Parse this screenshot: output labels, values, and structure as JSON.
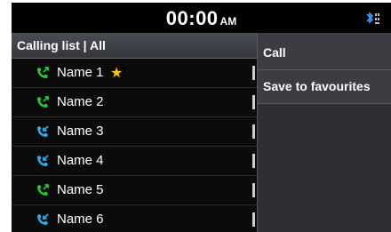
{
  "status": {
    "time": "00:00",
    "ampm": "AM",
    "bluetooth_icon": "bluetooth-signal-icon"
  },
  "header": {
    "title": "Calling list | All"
  },
  "contacts": [
    {
      "name": "Name 1",
      "call_type": "outgoing",
      "icon_color": "#29c837",
      "favourite": true
    },
    {
      "name": "Name 2",
      "call_type": "outgoing",
      "icon_color": "#29c837",
      "favourite": false
    },
    {
      "name": "Name 3",
      "call_type": "incoming",
      "icon_color": "#33a8ea",
      "favourite": false
    },
    {
      "name": "Name 4",
      "call_type": "incoming",
      "icon_color": "#33a8ea",
      "favourite": false
    },
    {
      "name": "Name 5",
      "call_type": "outgoing",
      "icon_color": "#29c837",
      "favourite": false
    },
    {
      "name": "Name 6",
      "call_type": "incoming",
      "icon_color": "#33a8ea",
      "favourite": false
    }
  ],
  "menu": {
    "items": [
      {
        "label": "Call"
      },
      {
        "label": "Save to favourites"
      }
    ]
  },
  "colors": {
    "background": "#0b0b0c",
    "menu": "#3b3d42",
    "star": "#f5c518"
  }
}
